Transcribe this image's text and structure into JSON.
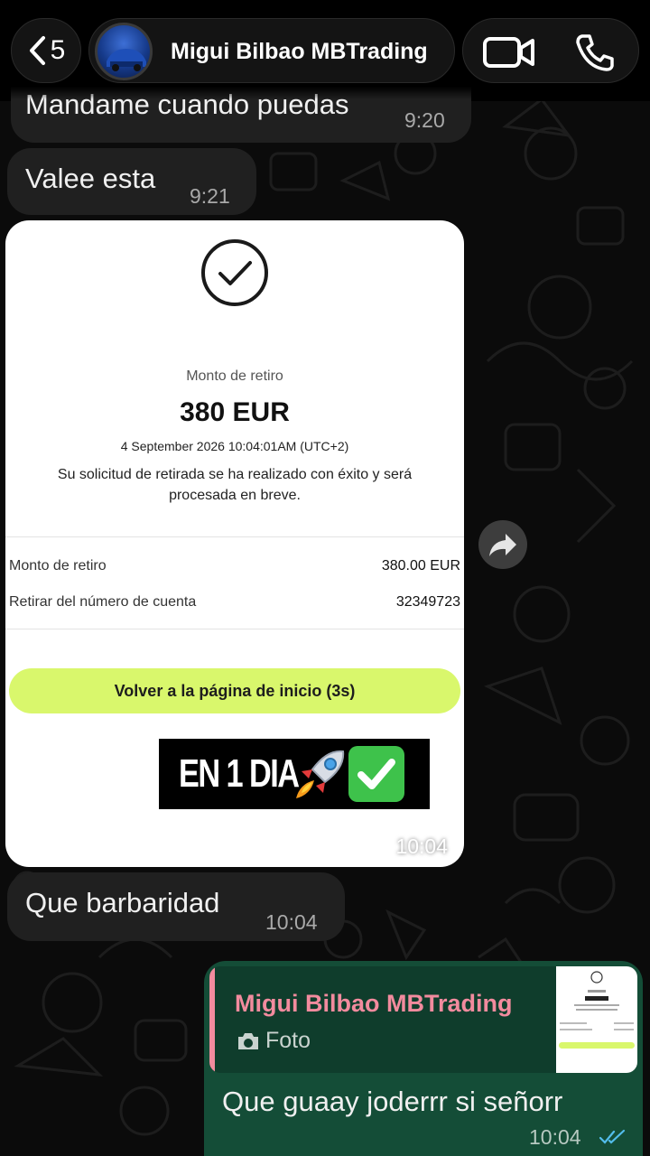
{
  "header": {
    "back_count": "5",
    "contact_name": "Migui Bilbao MBTrading"
  },
  "messages": [
    {
      "text": "Mandame cuando puedas",
      "time": "9:20"
    },
    {
      "text": "Valee esta",
      "time": "9:21"
    },
    {
      "text": "Que barbaridad",
      "time": "10:04"
    }
  ],
  "image_message": {
    "time": "10:04",
    "receipt": {
      "title": "Monto de retiro",
      "amount": "380 EUR",
      "date": "4 September 2026 10:04:01AM (UTC+2)",
      "description": "Su solicitud de retirada se ha realizado con éxito y será procesada en breve.",
      "rows": [
        {
          "label": "Monto de retiro",
          "value": "380.00 EUR"
        },
        {
          "label": "Retirar del número de cuenta",
          "value": "32349723"
        }
      ],
      "button_label": "Volver a la página de inicio (3s)"
    },
    "banner_text": "EN 1 DIA"
  },
  "outgoing": {
    "quoted_name": "Migui Bilbao MBTrading",
    "quoted_type": "Foto",
    "text": "Que guaay joderrr si señorr",
    "time": "10:04",
    "read_status": "read"
  },
  "colors": {
    "incoming_bubble": "#202020",
    "outgoing_bubble": "#144d37",
    "quote_accent": "#f28b9e",
    "home_button": "#d9f76c",
    "read_ticks": "#53bdeb"
  },
  "icons": [
    "chevron-left-icon",
    "video-call-icon",
    "phone-icon",
    "checkmark-circle-icon",
    "forward-icon",
    "camera-icon",
    "rocket-icon",
    "check-mark-button-icon",
    "double-check-icon"
  ]
}
